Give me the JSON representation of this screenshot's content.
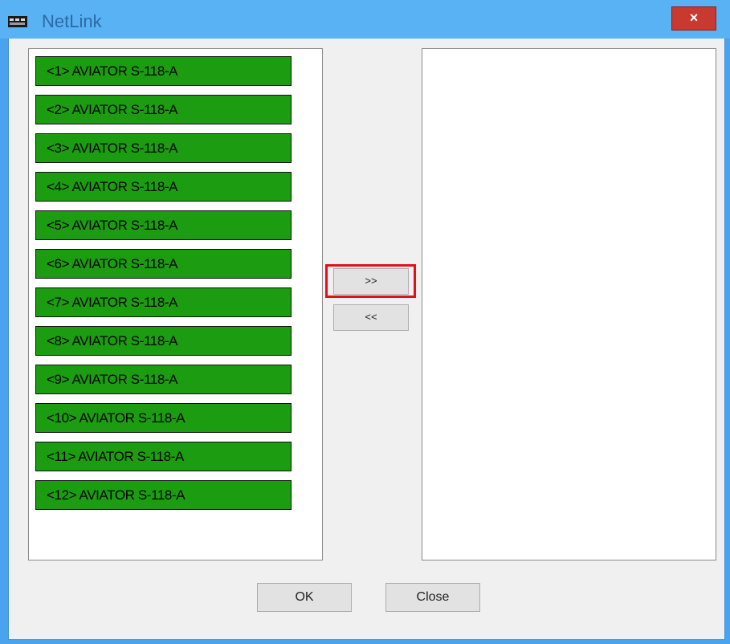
{
  "window": {
    "title": "NetLink",
    "close_label": "×"
  },
  "left_list": {
    "items": [
      "<1> AVIATOR S-118-A",
      "<2> AVIATOR S-118-A",
      "<3> AVIATOR S-118-A",
      "<4> AVIATOR S-118-A",
      "<5> AVIATOR S-118-A",
      "<6> AVIATOR S-118-A",
      "<7> AVIATOR S-118-A",
      "<8> AVIATOR S-118-A",
      "<9> AVIATOR S-118-A",
      "<10> AVIATOR S-118-A",
      "<11> AVIATOR S-118-A",
      "<12> AVIATOR S-118-A"
    ],
    "item_color": "#1c9c10"
  },
  "right_list": {
    "items": []
  },
  "transfer": {
    "add_label": ">>",
    "remove_label": "<<",
    "highlight_color": "#e2101a"
  },
  "footer": {
    "ok_label": "OK",
    "close_label": "Close"
  }
}
